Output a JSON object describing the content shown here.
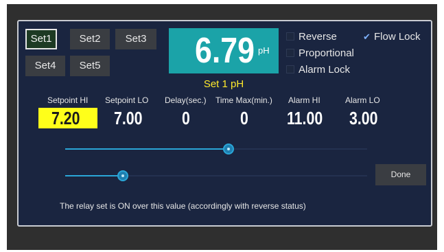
{
  "sets": {
    "set1": "Set1",
    "set2": "Set2",
    "set3": "Set3",
    "set4": "Set4",
    "set5": "Set5"
  },
  "reading": {
    "value": "6.79",
    "unit": "pH",
    "set_label": "Set 1 pH"
  },
  "options": {
    "reverse": {
      "label": "Reverse",
      "checked": false
    },
    "proportional": {
      "label": "Proportional",
      "checked": false
    },
    "alarm_lock": {
      "label": "Alarm Lock",
      "checked": false
    },
    "flow_lock": {
      "label": "Flow Lock",
      "checked": true
    }
  },
  "params": {
    "setpoint_hi": {
      "label": "Setpoint HI",
      "value": "7.20"
    },
    "setpoint_lo": {
      "label": "Setpoint LO",
      "value": "7.00"
    },
    "delay": {
      "label": "Delay(sec.)",
      "value": "0"
    },
    "time_max": {
      "label": "Time Max(min.)",
      "value": "0"
    },
    "alarm_hi": {
      "label": "Alarm HI",
      "value": "11.00"
    },
    "alarm_lo": {
      "label": "Alarm LO",
      "value": "3.00"
    }
  },
  "sliders": {
    "upper_fraction": 0.54,
    "lower_fraction": 0.19
  },
  "done_label": "Done",
  "note": "The relay set is ON over this value (accordingly with reverse status)",
  "colors": {
    "panel": "#1a2540",
    "reading_bg": "#1ba3a8",
    "set_label": "#ffe92b",
    "selected_value_bg": "#ffff1a",
    "slider": "#2aa7d8"
  }
}
